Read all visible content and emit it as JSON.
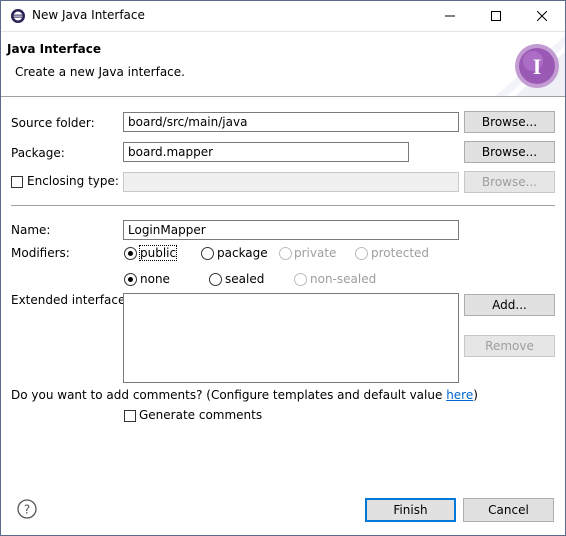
{
  "window": {
    "title": "New Java Interface"
  },
  "header": {
    "title": "Java Interface",
    "description": "Create a new Java interface."
  },
  "source_folder": {
    "label": "Source folder:",
    "value": "board/src/main/java",
    "browse": "Browse..."
  },
  "package": {
    "label": "Package:",
    "value": "board.mapper",
    "browse": "Browse..."
  },
  "enclosing_type": {
    "label": "Enclosing type:",
    "value": "",
    "browse": "Browse..."
  },
  "name": {
    "label": "Name:",
    "value": "LoginMapper"
  },
  "modifiers": {
    "label": "Modifiers:",
    "access": [
      "public",
      "package",
      "private",
      "protected"
    ],
    "selected_access": "public",
    "sealing": [
      "none",
      "sealed",
      "non-sealed"
    ],
    "selected_sealing": "none"
  },
  "extended_interfaces": {
    "label": "Extended interfaces:",
    "add": "Add...",
    "remove": "Remove"
  },
  "comments": {
    "question_prefix": "Do you want to add comments? (Configure templates and default value ",
    "link": "here",
    "question_suffix": ")",
    "generate_label": "Generate comments"
  },
  "footer": {
    "finish": "Finish",
    "cancel": "Cancel"
  },
  "colors": {
    "accent": "#0078d7",
    "link": "#0066cc",
    "wizard_icon": "#9b59b6"
  }
}
